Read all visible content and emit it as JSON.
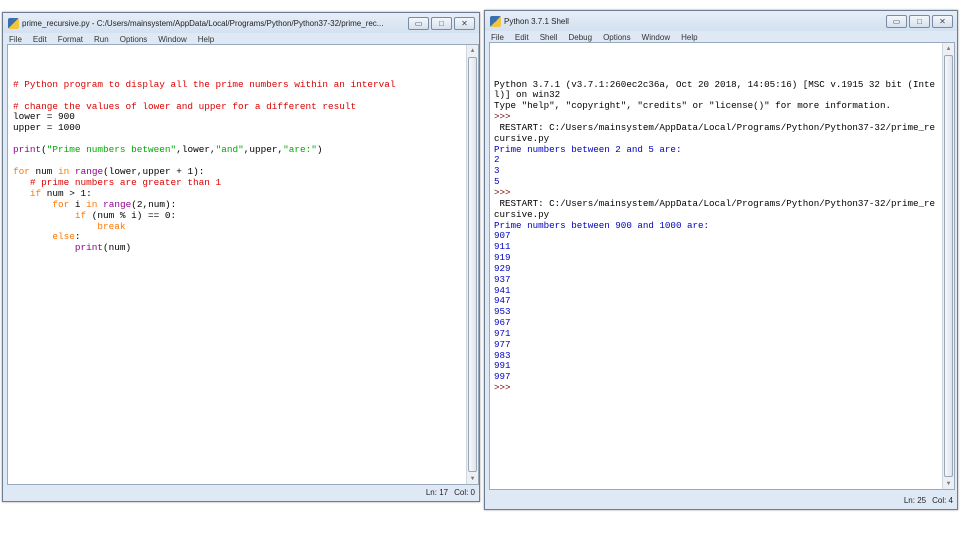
{
  "editor": {
    "title": "prime_recursive.py - C:/Users/mainsystem/AppData/Local/Programs/Python/Python37-32/prime_rec...",
    "menu": [
      "File",
      "Edit",
      "Format",
      "Run",
      "Options",
      "Window",
      "Help"
    ],
    "lines": [
      [
        [
          "# Python program to display all the prime numbers within an interval",
          "comment"
        ]
      ],
      [],
      [
        [
          "# change the values of lower and upper for a different result",
          "comment"
        ]
      ],
      [
        [
          "lower = 900",
          "def"
        ]
      ],
      [
        [
          "upper = 1000",
          "def"
        ]
      ],
      [],
      [
        [
          "print",
          "bi"
        ],
        [
          "(",
          "def"
        ],
        [
          "\"Prime numbers between\"",
          "str"
        ],
        [
          ",lower,",
          "def"
        ],
        [
          "\"and\"",
          "str"
        ],
        [
          ",upper,",
          "def"
        ],
        [
          "\"are:\"",
          "str"
        ],
        [
          ")",
          "def"
        ]
      ],
      [],
      [
        [
          "for",
          "kw"
        ],
        [
          " num ",
          "def"
        ],
        [
          "in",
          "kw"
        ],
        [
          " ",
          "def"
        ],
        [
          "range",
          "bi"
        ],
        [
          "(lower,upper + 1):",
          "def"
        ]
      ],
      [
        [
          "   # prime numbers are greater than 1",
          "comment"
        ]
      ],
      [
        [
          "   ",
          "def"
        ],
        [
          "if",
          "kw"
        ],
        [
          " num > 1:",
          "def"
        ]
      ],
      [
        [
          "       ",
          "def"
        ],
        [
          "for",
          "kw"
        ],
        [
          " i ",
          "def"
        ],
        [
          "in",
          "kw"
        ],
        [
          " ",
          "def"
        ],
        [
          "range",
          "bi"
        ],
        [
          "(2,num):",
          "def"
        ]
      ],
      [
        [
          "           ",
          "def"
        ],
        [
          "if",
          "kw"
        ],
        [
          " (num % i) == 0:",
          "def"
        ]
      ],
      [
        [
          "               ",
          "def"
        ],
        [
          "break",
          "kw"
        ]
      ],
      [
        [
          "       ",
          "def"
        ],
        [
          "else",
          "kw"
        ],
        [
          ":",
          "def"
        ]
      ],
      [
        [
          "           ",
          "def"
        ],
        [
          "print",
          "bi"
        ],
        [
          "(num)",
          "def"
        ]
      ]
    ],
    "status": {
      "line": "Ln: 17",
      "col": "Col: 0"
    }
  },
  "shell": {
    "title": "Python 3.7.1 Shell",
    "menu": [
      "File",
      "Edit",
      "Shell",
      "Debug",
      "Options",
      "Window",
      "Help"
    ],
    "lines": [
      [
        "Python 3.7.1 (v3.7.1:260ec2c36a, Oct 20 2018, 14:05:16) [MSC v.1915 32 bit (Inte",
        "plain"
      ],
      [
        "l)] on win32",
        "plain"
      ],
      [
        "Type \"help\", \"copyright\", \"credits\" or \"license()\" for more information.",
        "plain"
      ],
      [
        ">>> ",
        "prompt"
      ],
      [
        " RESTART: C:/Users/mainsystem/AppData/Local/Programs/Python/Python37-32/prime_re",
        "plain"
      ],
      [
        "cursive.py",
        "plain"
      ],
      [
        "Prime numbers between 2 and 5 are:",
        "out"
      ],
      [
        "2",
        "out"
      ],
      [
        "3",
        "out"
      ],
      [
        "5",
        "out"
      ],
      [
        ">>> ",
        "prompt"
      ],
      [
        " RESTART: C:/Users/mainsystem/AppData/Local/Programs/Python/Python37-32/prime_re",
        "plain"
      ],
      [
        "cursive.py",
        "plain"
      ],
      [
        "Prime numbers between 900 and 1000 are:",
        "out"
      ],
      [
        "907",
        "out"
      ],
      [
        "911",
        "out"
      ],
      [
        "919",
        "out"
      ],
      [
        "929",
        "out"
      ],
      [
        "937",
        "out"
      ],
      [
        "941",
        "out"
      ],
      [
        "947",
        "out"
      ],
      [
        "953",
        "out"
      ],
      [
        "967",
        "out"
      ],
      [
        "971",
        "out"
      ],
      [
        "977",
        "out"
      ],
      [
        "983",
        "out"
      ],
      [
        "991",
        "out"
      ],
      [
        "997",
        "out"
      ],
      [
        ">>> ",
        "prompt"
      ]
    ],
    "status": {
      "line": "Ln: 25",
      "col": "Col: 4"
    }
  },
  "window_controls": {
    "minimize": "▭",
    "maximize": "□",
    "close": "✕"
  },
  "colors": {
    "comment": "#dd0000",
    "keyword": "#ff7700",
    "builtin": "#900090",
    "string": "#00aa00",
    "output": "#0000c0"
  }
}
